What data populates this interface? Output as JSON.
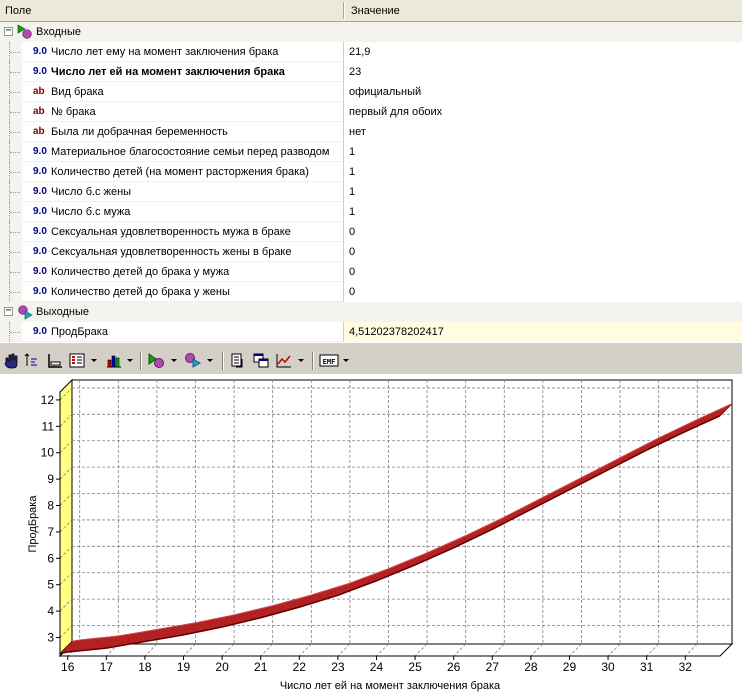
{
  "grid": {
    "columns": {
      "field": "Поле",
      "value": "Значение"
    },
    "inputs_label": "Входные",
    "outputs_label": "Выходные",
    "input_rows": [
      {
        "type": "9.0",
        "label": "Число лет ему на момент заключения брака",
        "value": "21,9",
        "bold": false
      },
      {
        "type": "9.0",
        "label": "Число лет ей на момент заключения брака",
        "value": "23",
        "bold": true
      },
      {
        "type": "ab",
        "label": "Вид брака",
        "value": "официальный",
        "bold": false
      },
      {
        "type": "ab",
        "label": "№ брака",
        "value": "первый для обоих",
        "bold": false
      },
      {
        "type": "ab",
        "label": "Была ли добрачная беременность",
        "value": "нет",
        "bold": false
      },
      {
        "type": "9.0",
        "label": "Материальное благосостояние семьи перед разводом",
        "value": "1",
        "bold": false
      },
      {
        "type": "9.0",
        "label": "Количество детей (на момент расторжения брака)",
        "value": "1",
        "bold": false
      },
      {
        "type": "9.0",
        "label": "Число б.с жены",
        "value": "1",
        "bold": false
      },
      {
        "type": "9.0",
        "label": "Число б.с мужа",
        "value": "1",
        "bold": false
      },
      {
        "type": "9.0",
        "label": "Сексуальная удовлетворенность мужа в браке",
        "value": "0",
        "bold": false
      },
      {
        "type": "9.0",
        "label": "Сексуальная удовлетворенность жены в браке",
        "value": "0",
        "bold": false
      },
      {
        "type": "9.0",
        "label": "Количество детей до брака у мужа",
        "value": "0",
        "bold": false
      },
      {
        "type": "9.0",
        "label": "Количество детей до брака у жены",
        "value": "0",
        "bold": false
      }
    ],
    "output_rows": [
      {
        "type": "9.0",
        "label": "ПродБрака",
        "value": "4,51202378202417",
        "bold": false
      }
    ]
  },
  "toolbar": {
    "icons": [
      "hand-icon",
      "cursor-axis-icon",
      "axes-icon",
      "legend-icon",
      "bar-chart-icon",
      "input-node-icon",
      "output-node-icon",
      "copy-icon",
      "windows-icon",
      "line-chart-icon",
      "emf-export-icon"
    ]
  },
  "chart_data": {
    "type": "line",
    "title": "",
    "xlabel": "Число лет ей на момент заключения брака",
    "ylabel": "ПродБрака",
    "xlim": [
      15.8,
      32.9
    ],
    "ylim": [
      2.3,
      12.3
    ],
    "xticks": [
      16,
      17,
      18,
      19,
      20,
      21,
      22,
      23,
      24,
      25,
      26,
      27,
      28,
      29,
      30,
      31,
      32
    ],
    "yticks": [
      3,
      4,
      5,
      6,
      7,
      8,
      9,
      10,
      11,
      12
    ],
    "grid": true,
    "series": [
      {
        "x": [
          15.8,
          16,
          17,
          18,
          19,
          20,
          21,
          22,
          23,
          24,
          25,
          26,
          27,
          28,
          29,
          30,
          31,
          32,
          32.9
        ],
        "values": [
          2.4,
          2.45,
          2.6,
          2.85,
          3.1,
          3.4,
          3.75,
          4.15,
          4.6,
          5.15,
          5.75,
          6.4,
          7.1,
          7.85,
          8.6,
          9.35,
          10.1,
          10.8,
          11.4
        ]
      }
    ],
    "colors": {
      "series": "#b22222",
      "wall": "#ffff80",
      "grid": "#808080"
    }
  }
}
